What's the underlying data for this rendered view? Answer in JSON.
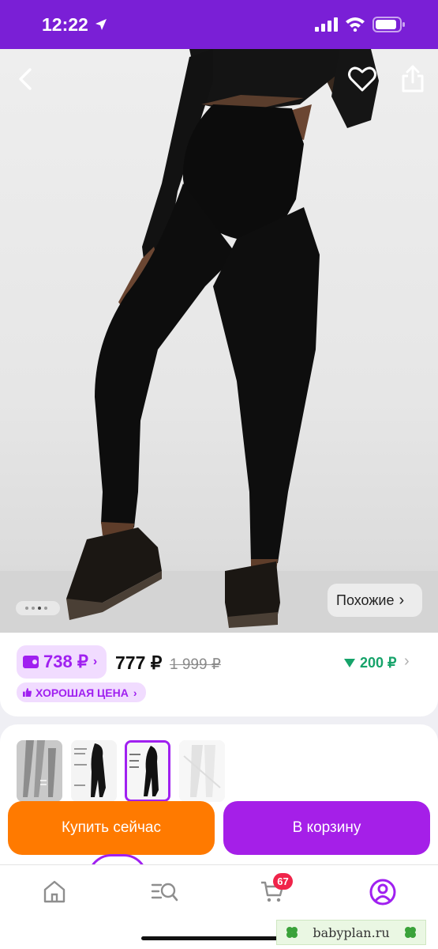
{
  "status_bar": {
    "time": "12:22"
  },
  "hero": {
    "similar_label": "Похожие",
    "similar_chevron": "›",
    "image_count": 4,
    "active_image": 3
  },
  "price": {
    "wallet_price": "738 ₽",
    "wallet_chevron": "›",
    "current_price": "777 ₽",
    "old_price": "1 999 ₽",
    "price_drop": "200 ₽",
    "drop_chevron": "›",
    "good_price_label": "ХОРОШАЯ ЦЕНА",
    "good_price_chevron": "›"
  },
  "actions": {
    "buy_now_label": "Купить сейчас",
    "add_to_cart_label": "В корзину"
  },
  "tabbar": {
    "items": [
      "home-icon",
      "catalog-search-icon",
      "cart-icon",
      "profile-icon"
    ],
    "cart_badge": "67"
  },
  "watermark": {
    "text": "babyplan.ru"
  },
  "colors": {
    "brand_purple": "#a020f0",
    "status_bar": "#7a1fd6",
    "buy_orange": "#ff7a00",
    "price_drop_green": "#16a36a",
    "badge_red": "#f0244a"
  }
}
